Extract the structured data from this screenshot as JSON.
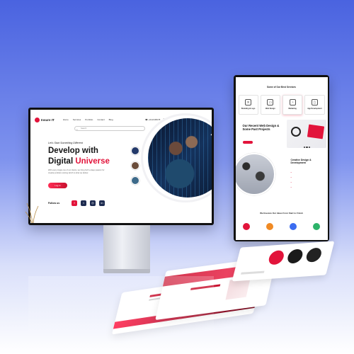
{
  "monitor": {
    "logo": "Insure IT",
    "nav": [
      "Home",
      "Services",
      "Portfolio",
      "Contact",
      "Blog"
    ],
    "nav_right": [
      "☎ +012345678",
      "☰"
    ],
    "search_placeholder": "Search",
    "kicker": "Let's Start Something Different",
    "headline_line1": "Develop with",
    "headline_line2_plain": "Digital ",
    "headline_line2_accent": "Universe",
    "description": "With every single one of our clients, we bring forth a deep passion for creative problem solving which is what we deliver.",
    "login_button": "Log In",
    "follow_label": "Follow us",
    "social_icons": [
      "f",
      "t",
      "◎",
      "in"
    ]
  },
  "tablet": {
    "services_title": "Some of Our Best Services",
    "services_subtitle": "",
    "services": [
      {
        "label": "Branding & Logo",
        "icon": "✕"
      },
      {
        "label": "Web Design",
        "icon": "▭"
      },
      {
        "label": "Marketing",
        "icon": "◔"
      },
      {
        "label": "App Development",
        "icon": "▯"
      }
    ],
    "section2_title": "Our Recent Web Design & Some Past Projects",
    "section2_desc": "",
    "section3_title": "Creative Design & Development",
    "section3_list": [
      "",
      "",
      "",
      ""
    ],
    "section4_title": "We Execute Our Ideas From Start to Finish",
    "colors": [
      "#e2143b",
      "#f08a24",
      "#3b6cf0",
      "#2db36a"
    ]
  }
}
